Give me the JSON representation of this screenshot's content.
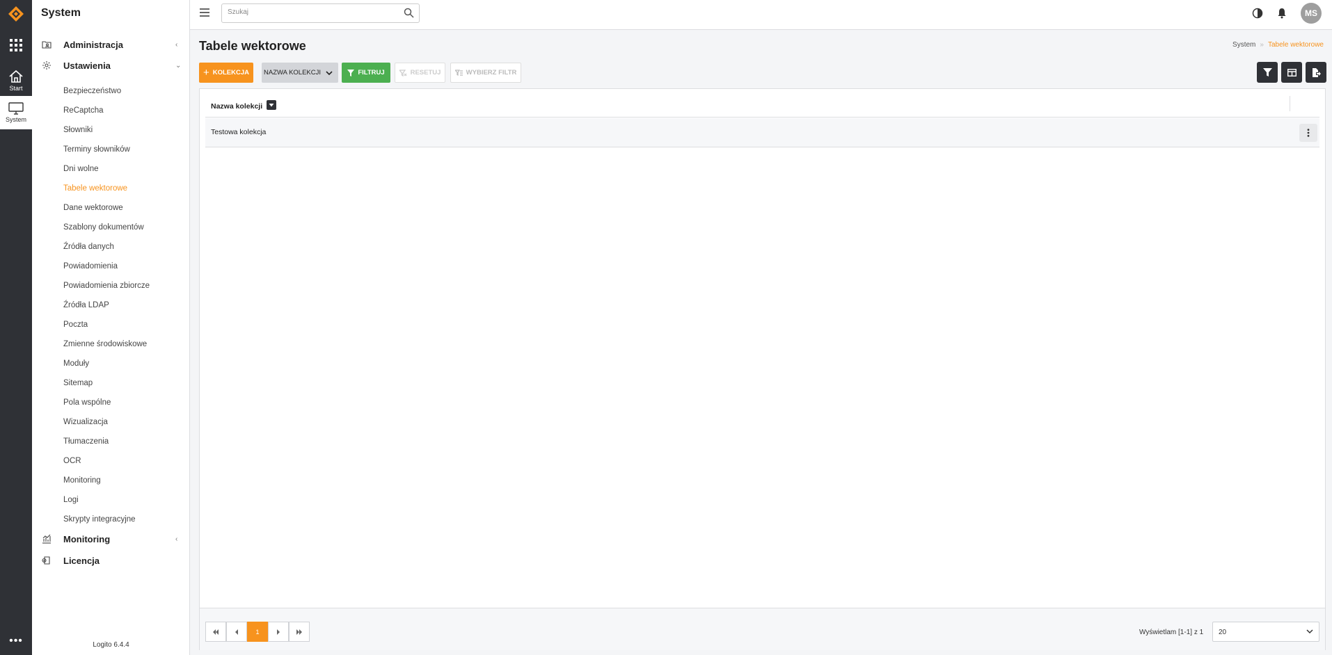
{
  "rail": {
    "start_label": "Start",
    "system_label": "System",
    "more_label": "•••"
  },
  "sidebar": {
    "title": "System",
    "sections": [
      {
        "label": "Administracja",
        "icon": "folder-user-icon"
      },
      {
        "label": "Ustawienia",
        "icon": "gear-icon"
      },
      {
        "label": "Monitoring",
        "icon": "chart-icon"
      },
      {
        "label": "Licencja",
        "icon": "license-icon"
      }
    ],
    "items": [
      "Bezpieczeństwo",
      "ReCaptcha",
      "Słowniki",
      "Terminy słowników",
      "Dni wolne",
      "Tabele wektorowe",
      "Dane wektorowe",
      "Szablony dokumentów",
      "Źródła danych",
      "Powiadomienia",
      "Powiadomienia zbiorcze",
      "Źródła LDAP",
      "Poczta",
      "Zmienne środowiskowe",
      "Moduły",
      "Sitemap",
      "Pola wspólne",
      "Wizualizacja",
      "Tłumaczenia",
      "OCR",
      "Monitoring",
      "Logi",
      "Skrypty integracyjne"
    ],
    "active_item": "Tabele wektorowe",
    "version": "Logito 6.4.4"
  },
  "topbar": {
    "search_placeholder": "Szukaj",
    "avatar_initials": "MS"
  },
  "page": {
    "title": "Tabele wektorowe",
    "breadcrumb": [
      "System",
      "Tabele wektorowe"
    ]
  },
  "toolbar": {
    "add_label": "KOLEKCJA",
    "field_label": "NAZWA KOLEKCJI",
    "filter_label": "FILTRUJ",
    "reset_label": "RESETUJ",
    "choose_filter_label": "WYBIERZ FILTR"
  },
  "table": {
    "columns": [
      "Nazwa kolekcji"
    ],
    "rows": [
      [
        "Testowa kolekcja"
      ]
    ]
  },
  "pagination": {
    "pages": [
      "1"
    ],
    "current_page": "1",
    "info": "Wyświetlam [1-1] z 1",
    "page_size": "20"
  },
  "colors": {
    "accent": "#f7931e",
    "filter_green": "#4caf50",
    "dark": "#2f3136"
  }
}
